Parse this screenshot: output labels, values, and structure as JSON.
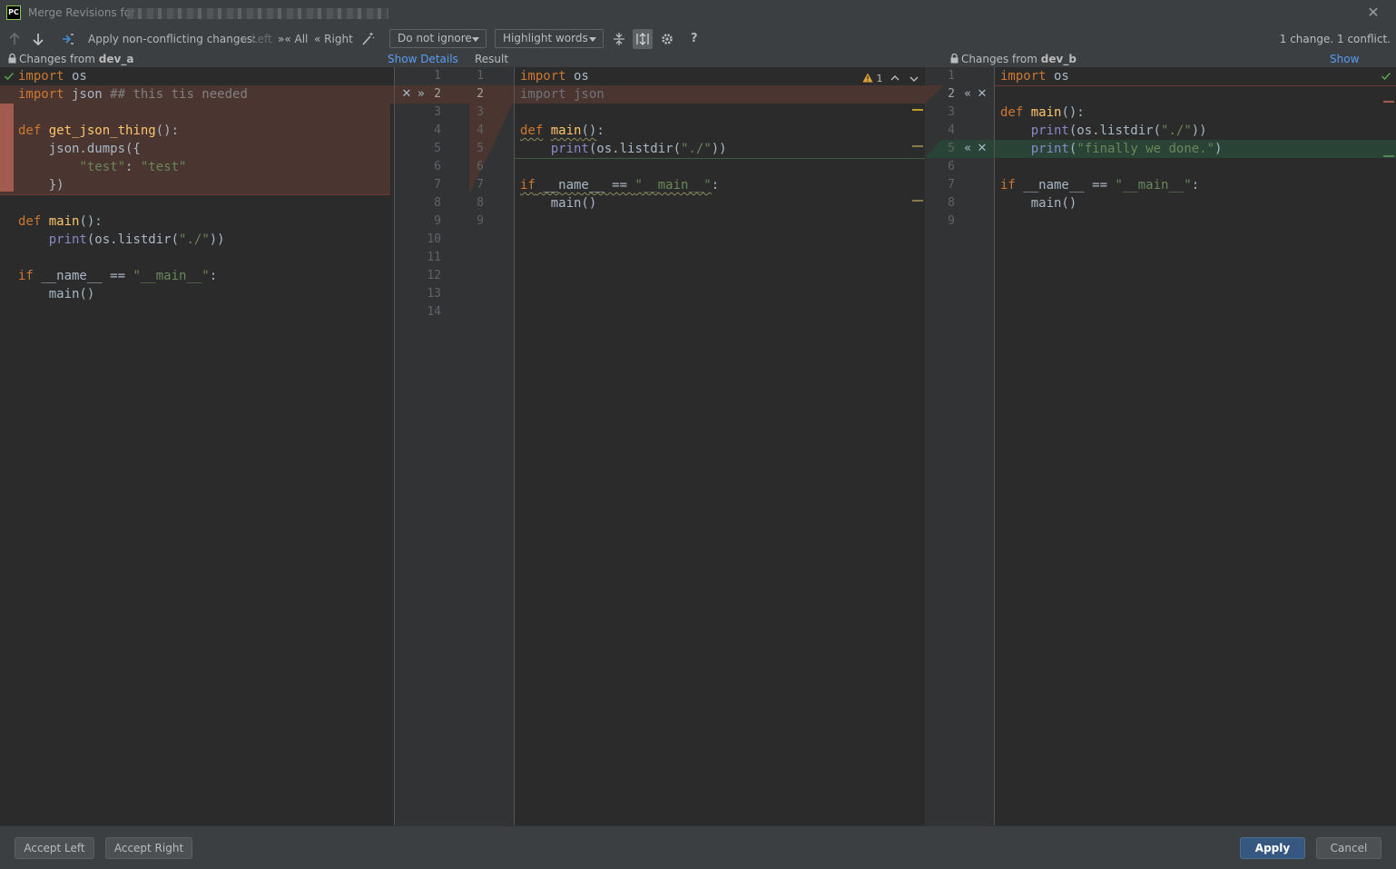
{
  "window": {
    "title": "Merge Revisions for",
    "close_label": "✕"
  },
  "toolbar": {
    "apply_label": "Apply non-conflicting changes:",
    "left_label": "Left",
    "all_label": "All",
    "right_label": "Right",
    "ignore_dropdown": "Do not ignore",
    "highlight_dropdown": "Highlight words",
    "help_label": "?",
    "status": "1 change. 1 conflict."
  },
  "headers": {
    "left_prefix": "Changes from",
    "left_branch": "dev_a",
    "middle_title": "Result",
    "right_prefix": "Changes from",
    "right_branch": "dev_b",
    "show_details": "Show Details"
  },
  "conflict_nav": {
    "count": "1"
  },
  "left_gutter_numbers": [
    "1",
    "2",
    "3",
    "4",
    "5",
    "6",
    "7",
    "8",
    "9",
    "10",
    "11",
    "12",
    "13",
    "14"
  ],
  "result_gutter_numbers": [
    "1",
    "2",
    "3",
    "4",
    "5",
    "6",
    "7",
    "8",
    "9"
  ],
  "right_gutter_numbers": [
    "1",
    "2",
    "3",
    "4",
    "5",
    "6",
    "7",
    "8",
    "9"
  ],
  "buttons": {
    "accept_left": "Accept Left",
    "accept_right": "Accept Right",
    "apply": "Apply",
    "cancel": "Cancel"
  },
  "colors": {
    "conflict_bg": "#4b3530",
    "added_bg": "#294436",
    "conflict_stripe": "#a35a4f",
    "accent_blue": "#589df6"
  }
}
